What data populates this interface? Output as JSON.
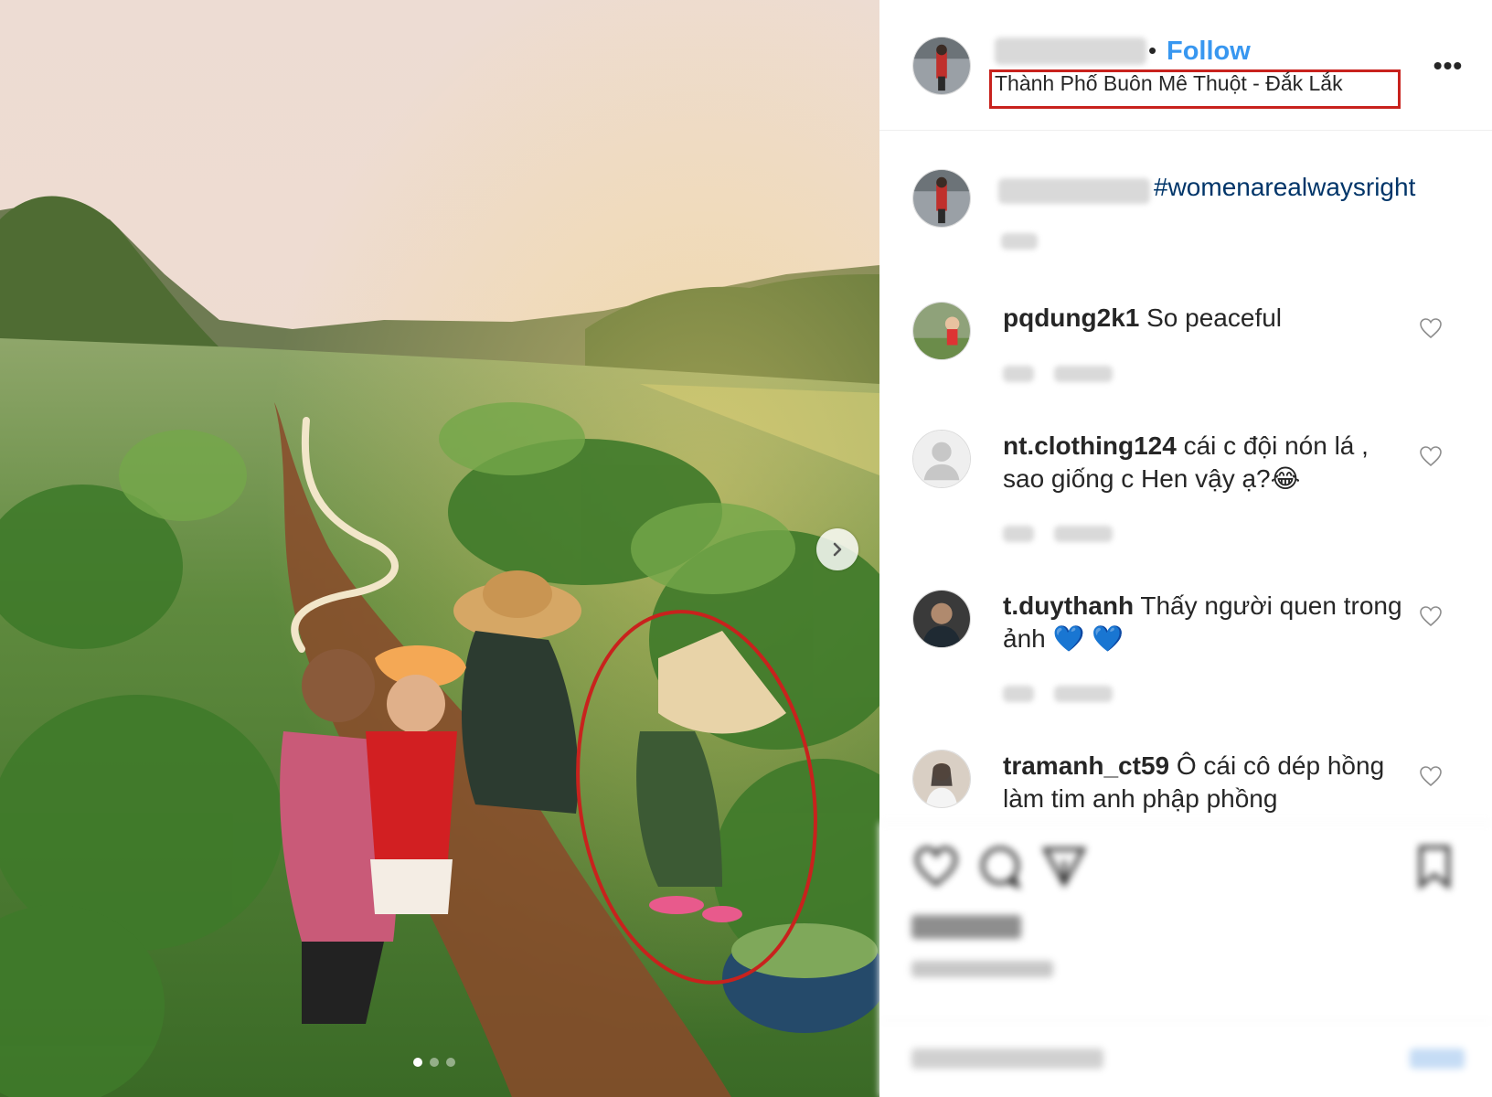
{
  "post": {
    "header": {
      "follow_label": "Follow",
      "location": "Thành Phố Buôn Mê Thuột - Đắk Lắk",
      "more_label": "•••"
    },
    "caption": {
      "hashtag": "#womenarealwaysright"
    },
    "comments": [
      {
        "username": "pqdung2k1",
        "text": "So peaceful"
      },
      {
        "username": "nt.clothing124",
        "text": "cái c đội nón lá , sao giống c Hen vậy ạ?😂"
      },
      {
        "username": "t.duythanh",
        "text": "Thấy người quen trong ảnh 💙 💙"
      },
      {
        "username": "tramanh_ct59",
        "text": "Ô cái cô dép hồng làm tim anh phập phồng"
      }
    ],
    "carousel": {
      "count": 3,
      "active": 1
    }
  },
  "colors": {
    "follow_blue": "#3897f0",
    "hashtag_navy": "#003569",
    "highlight_red": "#c8221d"
  },
  "icons": [
    "chevron-right-icon",
    "heart-icon",
    "comment-icon",
    "share-icon",
    "bookmark-icon"
  ]
}
